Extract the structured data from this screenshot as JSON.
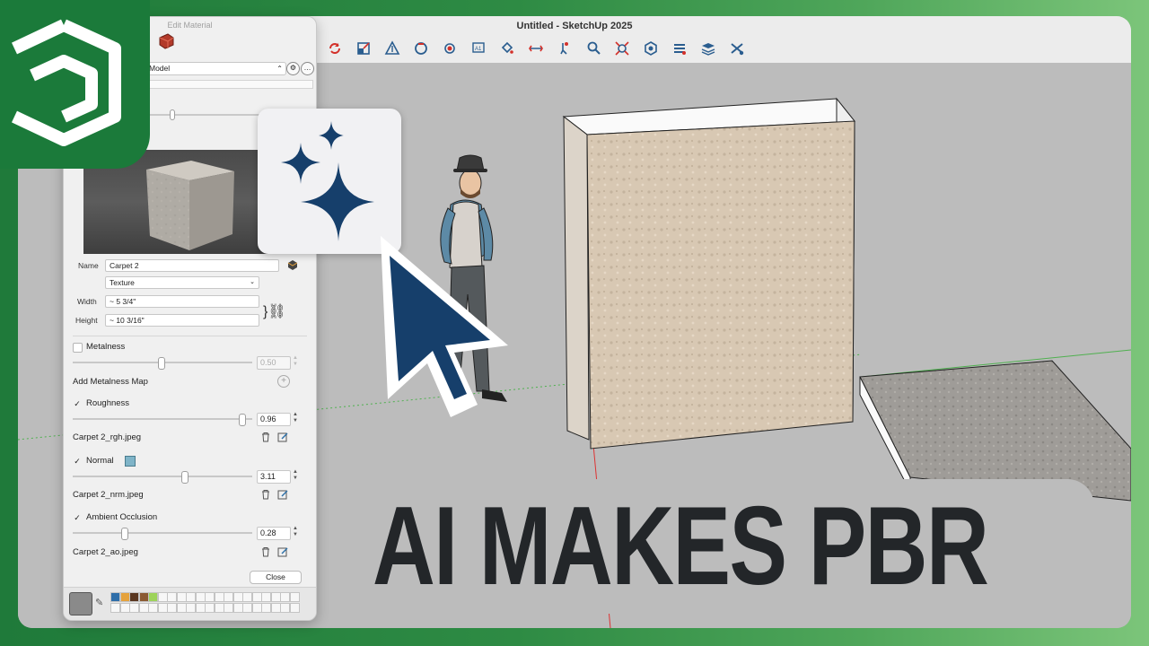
{
  "window": {
    "title": "Untitled - SketchUp 2025"
  },
  "toolbar": {
    "tools": [
      "rotate-icon",
      "scale-icon",
      "section-plane-icon",
      "orbit-icon",
      "look-around-icon",
      "text-label-icon",
      "paint-bucket-icon",
      "flip-icon",
      "walk-icon",
      "zoom-icon",
      "zoom-extents-icon",
      "extension-warehouse-icon",
      "components-icon",
      "layers-icon",
      "materials-icon"
    ]
  },
  "panel": {
    "title": "Edit Material",
    "model_select": "Model",
    "name_label": "Name",
    "name_value": "Carpet 2",
    "texture_select": "Texture",
    "width_label": "Width",
    "width_value": "~ 5 3/4\"",
    "height_label": "Height",
    "height_value": "~ 10 3/16\"",
    "metalness": {
      "label": "Metalness",
      "checked": false,
      "value": "0.50",
      "level": 0.5
    },
    "add_metalness_map": "Add Metalness Map",
    "roughness": {
      "label": "Roughness",
      "checked": true,
      "value": "0.96",
      "level": 0.96,
      "file": "Carpet 2_rgh.jpeg"
    },
    "normal": {
      "label": "Normal",
      "checked": true,
      "value": "3.11",
      "level": 0.62,
      "file": "Carpet 2_nrm.jpeg"
    },
    "ao": {
      "label": "Ambient Occlusion",
      "checked": true,
      "value": "0.28",
      "level": 0.28,
      "file": "Carpet 2_ao.jpeg"
    },
    "close_label": "Close",
    "palette_colors": [
      "#2f6ea9",
      "#e5a23c",
      "#5a3720",
      "#8b5a33",
      "#9dd35a"
    ]
  },
  "headline": "AI MAKES PBR",
  "colors": {
    "brand_green": "#1b7a3a",
    "accent_blue": "#163f6b"
  }
}
